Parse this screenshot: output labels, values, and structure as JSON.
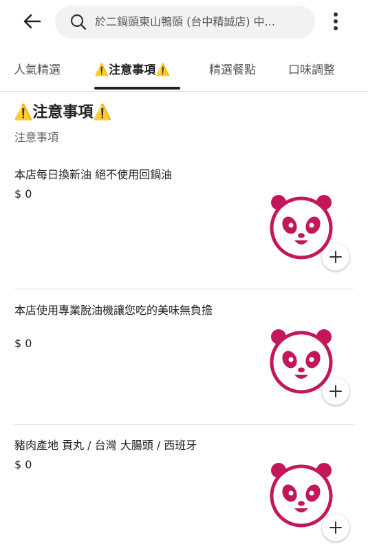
{
  "header": {
    "search_text": "於二鍋頭東山鴨頭 (台中精誠店) 中..."
  },
  "tabs": [
    {
      "label": "人氣精選"
    },
    {
      "label": "⚠️注意事項⚠️"
    },
    {
      "label": "精選餐點"
    },
    {
      "label": "口味調整"
    }
  ],
  "section": {
    "title": "⚠️注意事項⚠️",
    "subtitle": "注意事項"
  },
  "items": [
    {
      "name": "本店每日換新油 絕不使用回鍋油",
      "price": "$ 0"
    },
    {
      "name": "本店使用專業脫油機讓您吃的美味無負擔",
      "price": "$ 0"
    },
    {
      "name": "豬肉產地  貢丸 / 台灣  大腸頭 / 西班牙",
      "price": "$ 0"
    }
  ],
  "colors": {
    "brand": "#c2185b",
    "text": "#222222",
    "muted": "#666666",
    "search_bg": "#f2f2f4"
  },
  "icons": {
    "back": "arrow-left-icon",
    "search": "search-icon",
    "more": "more-vertical-icon",
    "item_image": "foodpanda-logo-icon",
    "add": "plus-icon"
  }
}
